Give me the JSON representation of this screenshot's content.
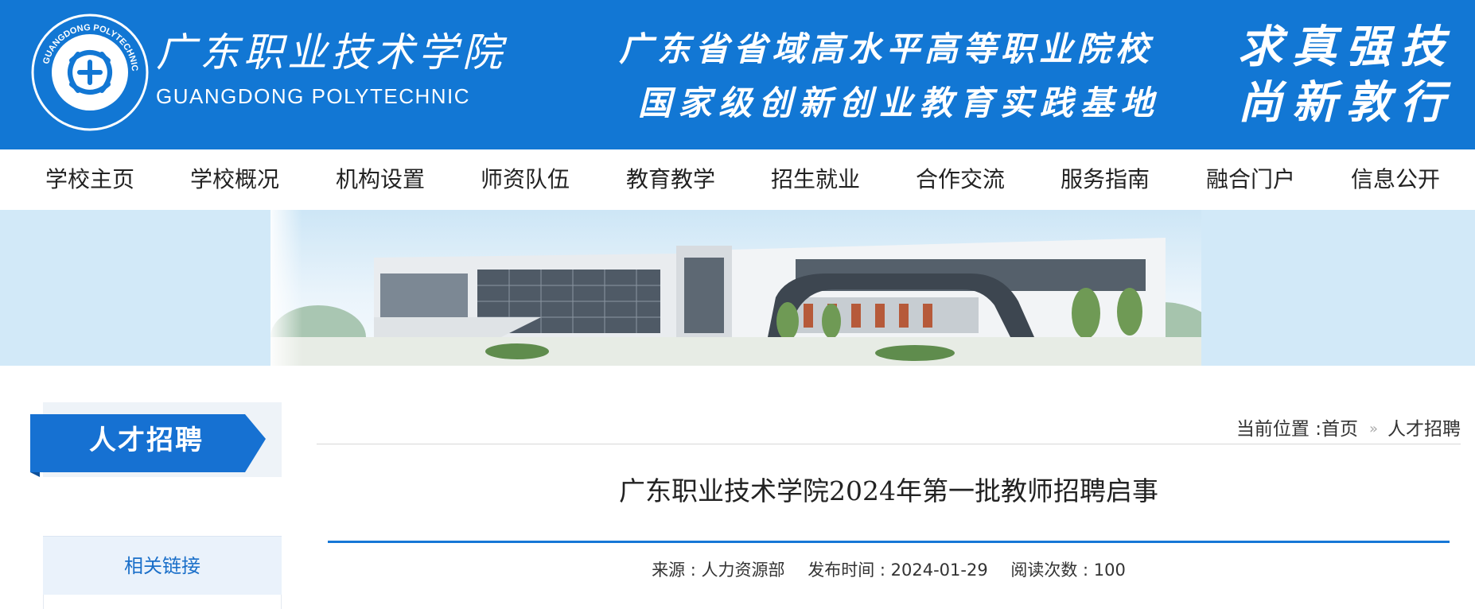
{
  "header": {
    "logo_cn": "广东职业技术学院",
    "logo_en": "GUANGDONG POLYTECHNIC",
    "emblem_ring_text": "GUANGDONG POLYTECHNIC",
    "slogan_line1": "广东省省域高水平高等职业院校",
    "slogan_line2": "国家级创新创业教育实践基地",
    "motto_line1": "求真强技",
    "motto_line2": "尚新敦行",
    "bg_color": "#1277d4"
  },
  "nav": {
    "items": [
      {
        "label": "学校主页"
      },
      {
        "label": "学校概况"
      },
      {
        "label": "机构设置"
      },
      {
        "label": "师资队伍"
      },
      {
        "label": "教育教学"
      },
      {
        "label": "招生就业"
      },
      {
        "label": "合作交流"
      },
      {
        "label": "服务指南"
      },
      {
        "label": "融合门户"
      },
      {
        "label": "信息公开"
      }
    ]
  },
  "sidebar": {
    "section_title": "人才招聘",
    "links_title": "相关链接"
  },
  "breadcrumb": {
    "prefix": "当前位置 : ",
    "home": "首页",
    "separator": "»",
    "current": "人才招聘"
  },
  "article": {
    "title": "广东职业技术学院2024年第一批教师招聘启事",
    "source": "来源 : 人力资源部",
    "published": "发布时间 : 2024-01-29",
    "views": "阅读次数 : 100"
  },
  "colors": {
    "accent": "#1677d6",
    "link": "#1a6fc9"
  }
}
